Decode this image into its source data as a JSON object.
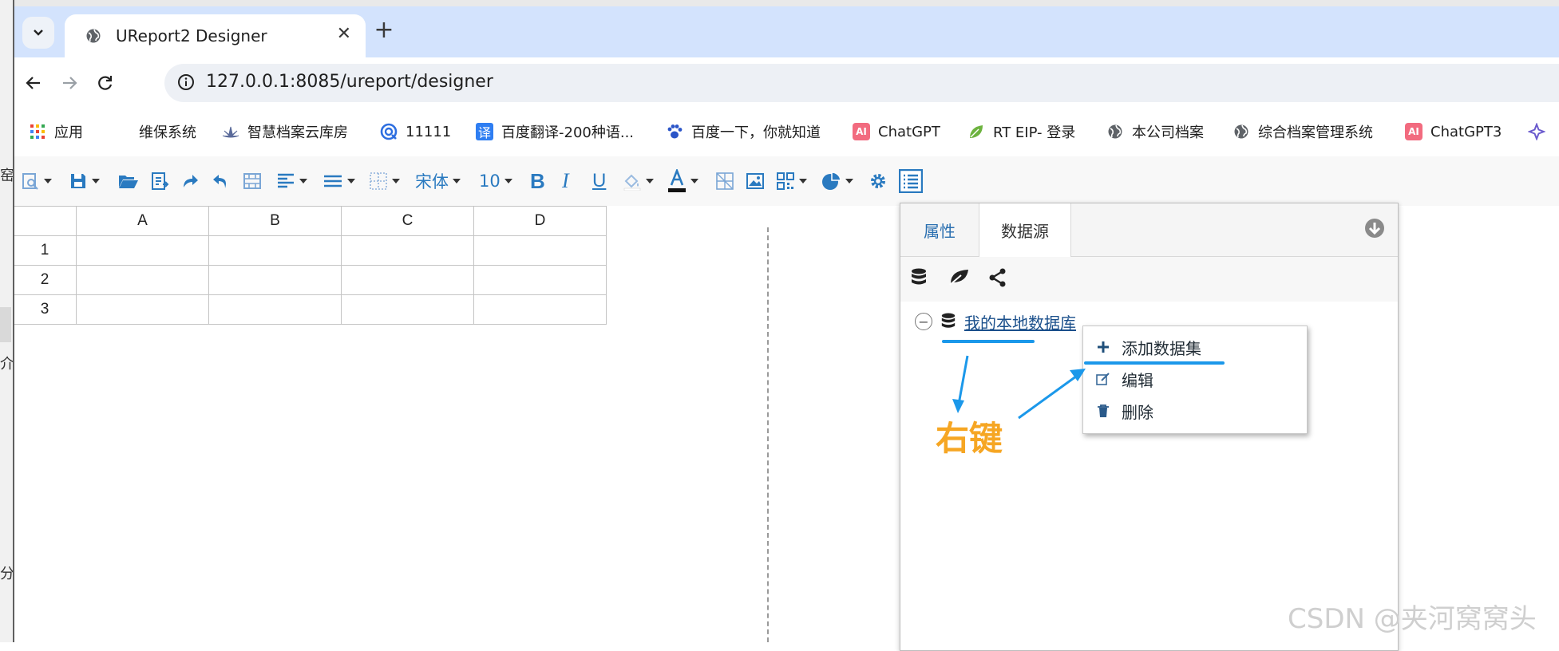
{
  "side_fragment": {
    "top": "窑",
    "mid": "介",
    "bottom": "分"
  },
  "browser": {
    "tab_title": "UReport2 Designer",
    "new_tab": "+",
    "url": "127.0.0.1:8085/ureport/designer",
    "bookmarks": [
      {
        "label": "应用",
        "icon": "apps-grid-icon"
      },
      {
        "label": "维保系统",
        "icon": "none"
      },
      {
        "label": "智慧档案云库房",
        "icon": "lotus-icon"
      },
      {
        "label": "11111",
        "icon": "target-icon"
      },
      {
        "label": "百度翻译-200种语...",
        "icon": "translate-icon"
      },
      {
        "label": "百度一下，你就知道",
        "icon": "paw-icon"
      },
      {
        "label": "ChatGPT",
        "icon": "ai-icon"
      },
      {
        "label": "RT EIP- 登录",
        "icon": "leaf-icon"
      },
      {
        "label": "本公司档案",
        "icon": "globe-icon"
      },
      {
        "label": "综合档案管理系统",
        "icon": "globe-icon"
      },
      {
        "label": "ChatGPT3",
        "icon": "ai-icon"
      }
    ]
  },
  "toolbar": {
    "font_name": "宋体",
    "font_size": "10"
  },
  "grid": {
    "columns": [
      "A",
      "B",
      "C",
      "D"
    ],
    "rows": [
      "1",
      "2",
      "3"
    ]
  },
  "panel": {
    "tabs": [
      "属性",
      "数据源"
    ],
    "active_tab": "数据源",
    "datasource": "我的本地数据库"
  },
  "context_menu": {
    "items": [
      {
        "label": "添加数据集",
        "icon": "plus-icon"
      },
      {
        "label": "编辑",
        "icon": "edit-icon"
      },
      {
        "label": "删除",
        "icon": "trash-icon"
      }
    ]
  },
  "annotation": {
    "text": "右键",
    "color": "#f6a623",
    "line_color": "#1b98ea"
  },
  "watermark": "CSDN @夹河窝窝头",
  "colors": {
    "tab_bar": "#d3e3fd",
    "toolbar_icon": "#2a7ac0",
    "link": "#1a4f8b"
  }
}
